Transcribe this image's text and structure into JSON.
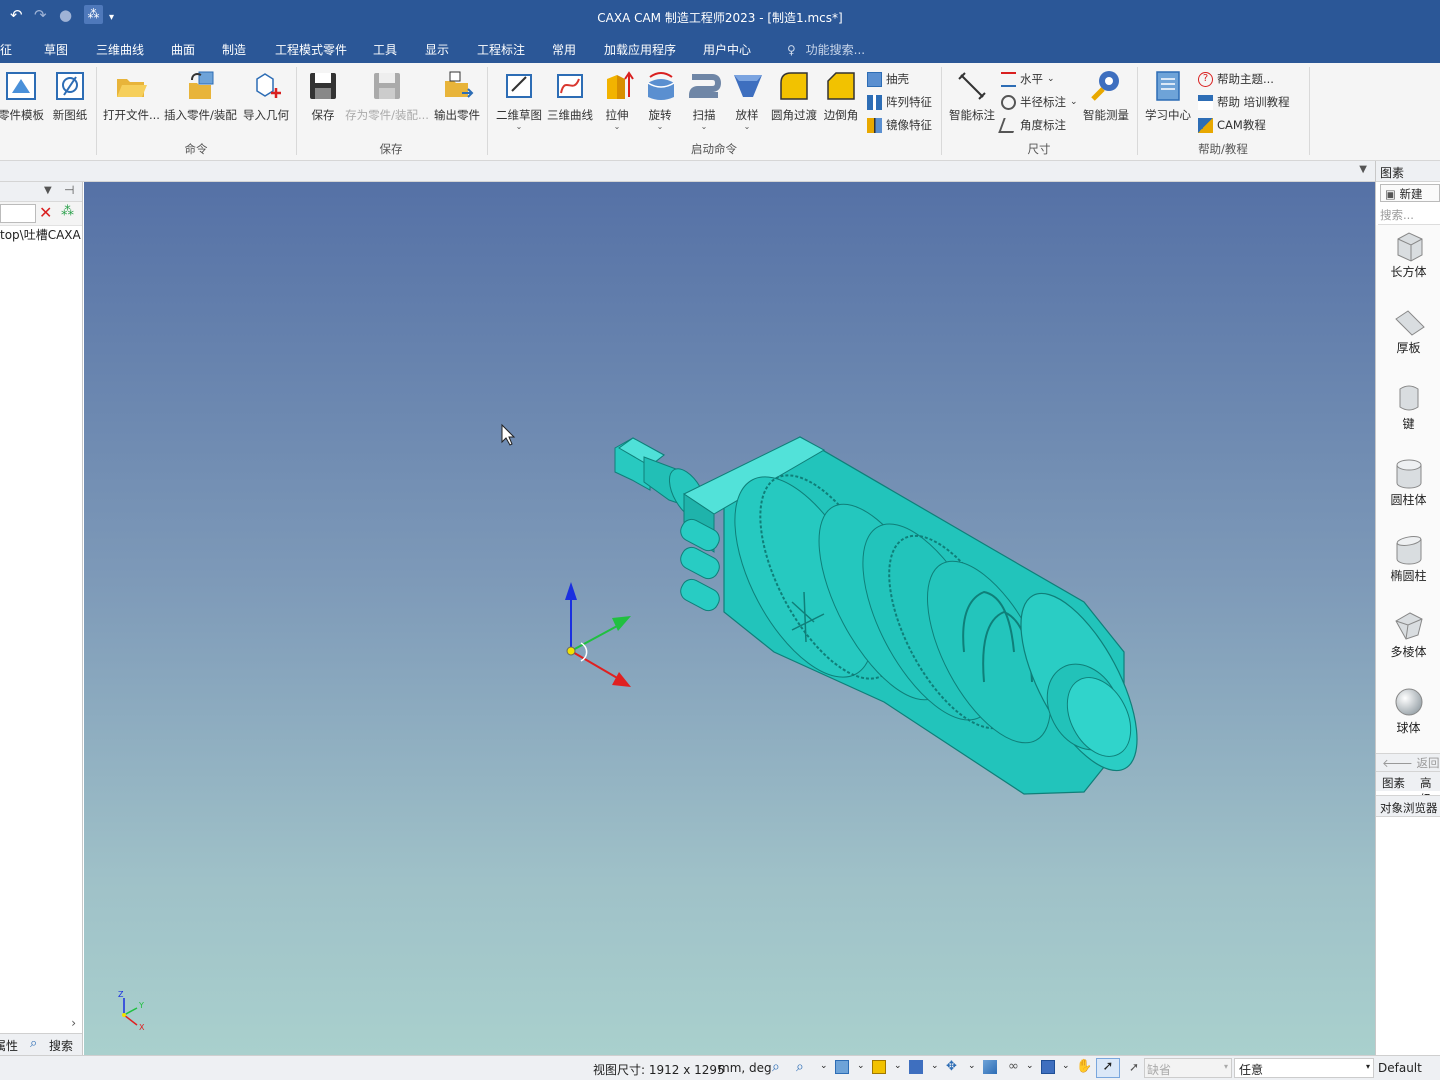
{
  "window": {
    "title": "CAXA CAM 制造工程师2023 - [制造1.mcs*]"
  },
  "menu": {
    "items": [
      "特征",
      "草图",
      "三维曲线",
      "曲面",
      "制造",
      "工程模式零件",
      "工具",
      "显示",
      "工程标注",
      "常用",
      "加载应用程序",
      "用户中心"
    ],
    "search_placeholder": "功能搜索..."
  },
  "ribbon": {
    "part_template": "零件模板",
    "new_drawing": "新图纸",
    "open_file": "打开文件...",
    "insert_part": "插入零件/装配",
    "import_geometry": "导入几何",
    "group_command": "命令",
    "save": "保存",
    "save_as": "存为零件/装配...",
    "export_part": "输出零件",
    "group_save": "保存",
    "sketch2d": "二维草图",
    "curve3d": "三维曲线",
    "extrude": "拉伸",
    "revolve": "旋转",
    "sweep": "扫描",
    "loft": "放样",
    "fillet": "圆角过渡",
    "chamfer": "边倒角",
    "shell": "抽壳",
    "pattern": "阵列特征",
    "mirror": "镜像特征",
    "group_launch": "启动命令",
    "smart_dim": "智能标注",
    "horizontal": "水平",
    "radius_dim": "半径标注",
    "angle_dim": "角度标注",
    "smart_measure": "智能测量",
    "group_dim": "尺寸",
    "learn_center": "学习中心",
    "help_topics": "帮助主题...",
    "help_training": "帮助 培训教程",
    "cam_tutorial": "CAM教程",
    "group_help": "帮助/教程"
  },
  "left_panel": {
    "tree_path": "top\\吐槽CAXA",
    "tab_properties": "属性",
    "tab_search": "搜索"
  },
  "right_panel": {
    "title": "图素",
    "new_button": "新建",
    "search_placeholder": "搜索...",
    "shapes": [
      "长方体",
      "厚板",
      "键",
      "圆柱体",
      "椭圆柱",
      "多棱体",
      "球体"
    ],
    "back_button": "返回",
    "tab_elements": "图素",
    "tab_advanced": "高级",
    "object_browser": "对象浏览器"
  },
  "status": {
    "view_size": "视图尺寸: 1912 x 1295",
    "units": "mm, deg",
    "default_select": "缺省",
    "any_select": "任意",
    "style": "Default"
  },
  "colors": {
    "titlebar": "#2b5797",
    "model": "#22c8c0",
    "axis_x": "#e02020",
    "axis_y": "#20c040",
    "axis_z": "#1a2fe0"
  }
}
